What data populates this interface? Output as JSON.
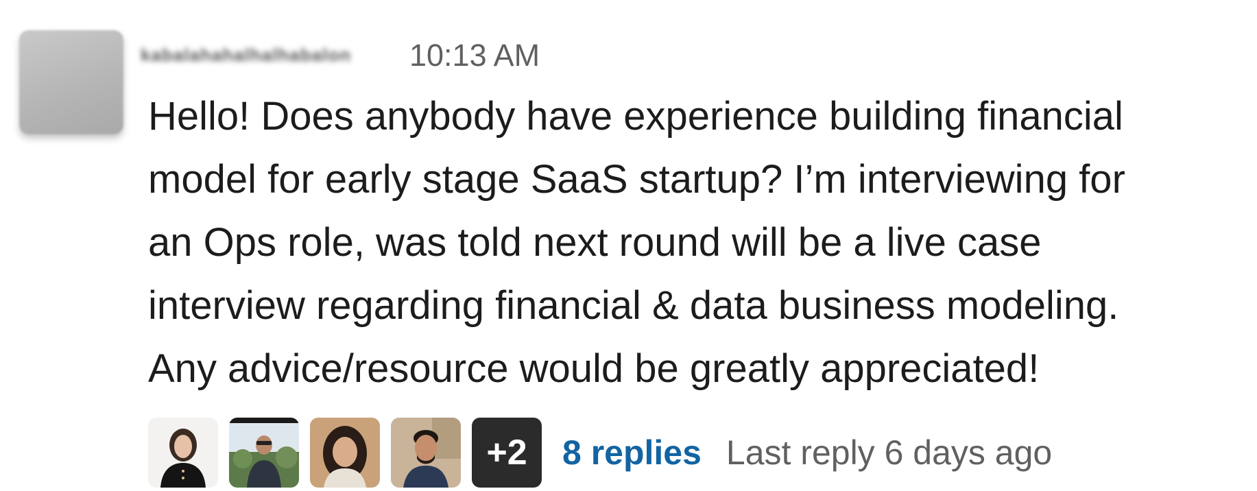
{
  "message": {
    "author_name": "kabalahahalhalhabalon",
    "timestamp": "10:13 AM",
    "text": "Hello! Does anybody have experience building financial\nmodel for early stage SaaS startup? I’m interviewing for\nan Ops role, was told next round will be a live case\ninterview regarding financial & data business modeling.\nAny advice/resource would be greatly appreciated!"
  },
  "thread": {
    "participants": [
      {
        "name": "participant-1"
      },
      {
        "name": "participant-2"
      },
      {
        "name": "participant-3"
      },
      {
        "name": "participant-4"
      }
    ],
    "more_participants": "+2",
    "replies_label": "8 replies",
    "last_reply": "Last reply 6 days ago"
  },
  "colors": {
    "link": "#1264a3",
    "muted": "#616061",
    "text": "#1d1c1d"
  }
}
